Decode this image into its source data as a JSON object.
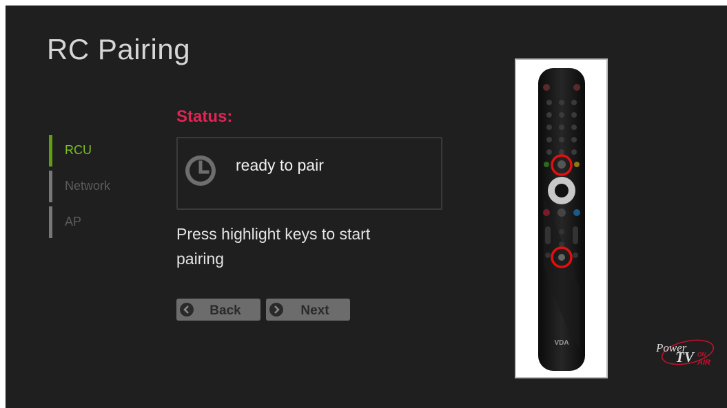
{
  "page": {
    "title": "RC Pairing"
  },
  "nav": {
    "items": [
      {
        "label": "RCU",
        "active": true
      },
      {
        "label": "Network",
        "active": false
      },
      {
        "label": "AP",
        "active": false
      }
    ]
  },
  "status": {
    "heading": "Status:",
    "icon": "clock-icon",
    "text": "ready to pair"
  },
  "instruction": "Press highlight keys to start pairing",
  "buttons": {
    "back": {
      "label": "Back",
      "icon": "chevron-left-icon"
    },
    "next": {
      "label": "Next",
      "icon": "chevron-right-icon"
    }
  },
  "remote": {
    "image": "remote-control-illustration",
    "highlight_color": "#e01010",
    "brand_mark": "VDA"
  },
  "logo": {
    "text_power": "Power",
    "text_tv": "TV",
    "text_on": "ON",
    "text_air": "AIR"
  },
  "colors": {
    "accent_active": "#7bbf20",
    "status_heading": "#e02454",
    "background": "#1f1f1f"
  }
}
